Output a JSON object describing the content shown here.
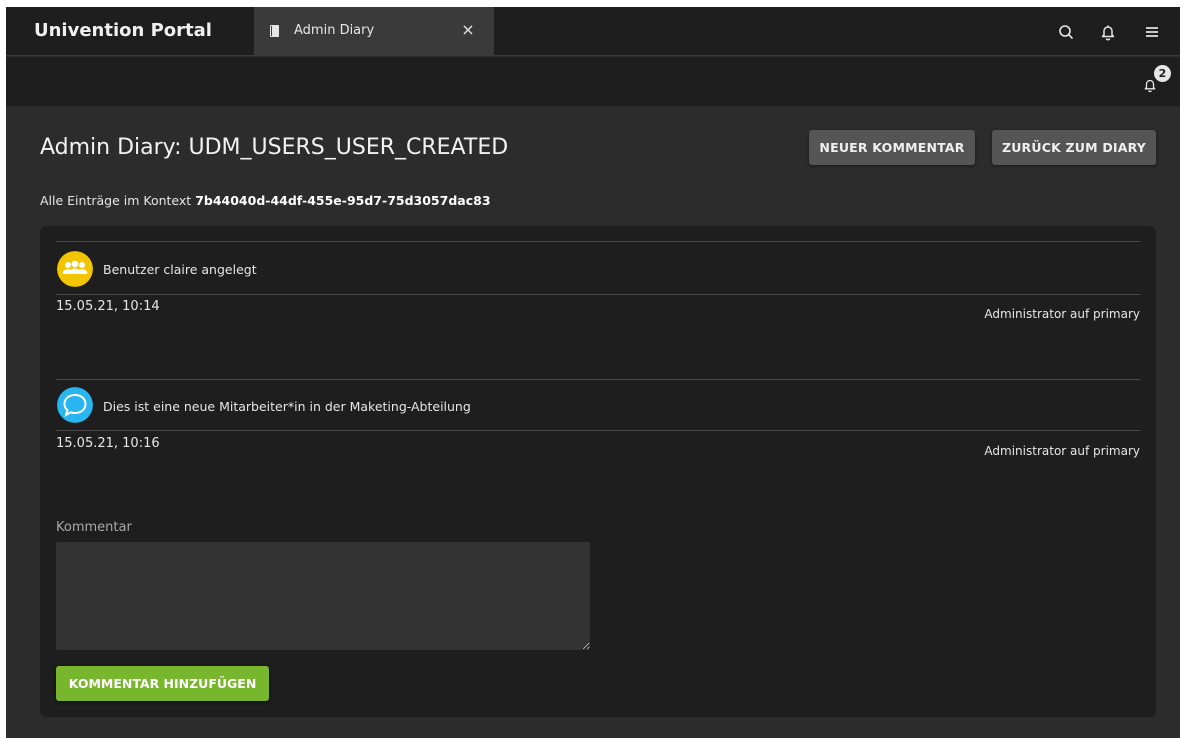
{
  "topbar": {
    "portal_title": "Univention Portal",
    "tab": {
      "label": "Admin Diary",
      "close": "×"
    }
  },
  "notifications": {
    "count": "2"
  },
  "page": {
    "title": "Admin Diary: UDM_USERS_USER_CREATED",
    "new_comment_button": "NEUER KOMMENTAR",
    "back_button": "ZURÜCK ZUM DIARY",
    "context_prefix": "Alle Einträge im Kontext",
    "context_id": "7b44040d-44df-455e-95d7-75d3057dac83"
  },
  "entries": [
    {
      "icon": "users-icon",
      "icon_color": "#f2c500",
      "message": "Benutzer claire angelegt",
      "date": "15.05.21, 10:14",
      "author": "Administrator auf primary"
    },
    {
      "icon": "comment-icon",
      "icon_color": "#29b6f0",
      "message": "Dies ist eine neue Mitarbeiter*in in der Maketing-Abteilung",
      "date": "15.05.21, 10:16",
      "author": "Administrator auf primary"
    }
  ],
  "comment_form": {
    "label": "Kommentar",
    "value": "",
    "submit_button": "KOMMENTAR HINZUFÜGEN"
  },
  "colors": {
    "accent_green": "#78b62e",
    "background": "#2c2c2c",
    "bar": "#1e1e1e"
  }
}
